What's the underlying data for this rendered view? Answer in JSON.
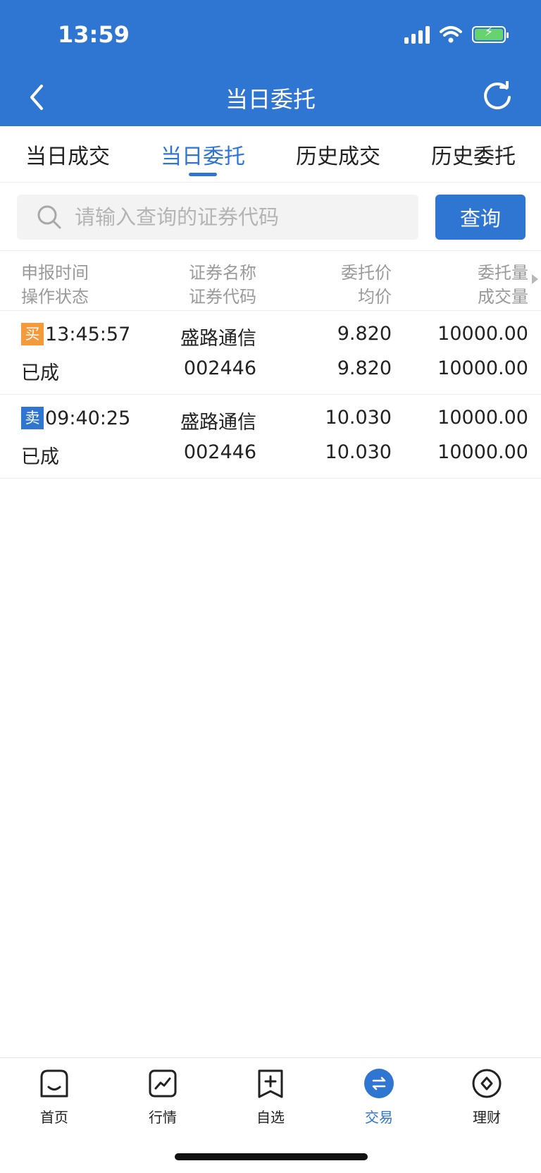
{
  "status_bar": {
    "time": "13:59"
  },
  "nav": {
    "title": "当日委托"
  },
  "tabs": [
    {
      "label": "当日成交",
      "active": false
    },
    {
      "label": "当日委托",
      "active": true
    },
    {
      "label": "历史成交",
      "active": false
    },
    {
      "label": "历史委托",
      "active": false
    }
  ],
  "search": {
    "placeholder": "请输入查询的证券代码",
    "button_label": "查询"
  },
  "columns": {
    "row1": [
      "申报时间",
      "证券名称",
      "委托价",
      "委托量"
    ],
    "row2": [
      "操作状态",
      "证券代码",
      "均价",
      "成交量"
    ]
  },
  "orders": [
    {
      "side": "买",
      "side_type": "buy",
      "time": "13:45:57",
      "name": "盛路通信",
      "price": "9.820",
      "qty": "10000.00",
      "status": "已成",
      "code": "002446",
      "avg_price": "9.820",
      "filled": "10000.00"
    },
    {
      "side": "卖",
      "side_type": "sell",
      "time": "09:40:25",
      "name": "盛路通信",
      "price": "10.030",
      "qty": "10000.00",
      "status": "已成",
      "code": "002446",
      "avg_price": "10.030",
      "filled": "10000.00"
    }
  ],
  "tabbar": [
    {
      "label": "首页",
      "icon": "home-icon",
      "active": false
    },
    {
      "label": "行情",
      "icon": "market-chart-icon",
      "active": false
    },
    {
      "label": "自选",
      "icon": "watchlist-add-icon",
      "active": false
    },
    {
      "label": "交易",
      "icon": "trade-exchange-icon",
      "active": true
    },
    {
      "label": "理财",
      "icon": "finance-diamond-icon",
      "active": false
    }
  ],
  "colors": {
    "brand": "#2f76d3",
    "buy_badge": "#f59a3a",
    "sell_badge": "#2f76d3",
    "battery": "#66d36e"
  }
}
